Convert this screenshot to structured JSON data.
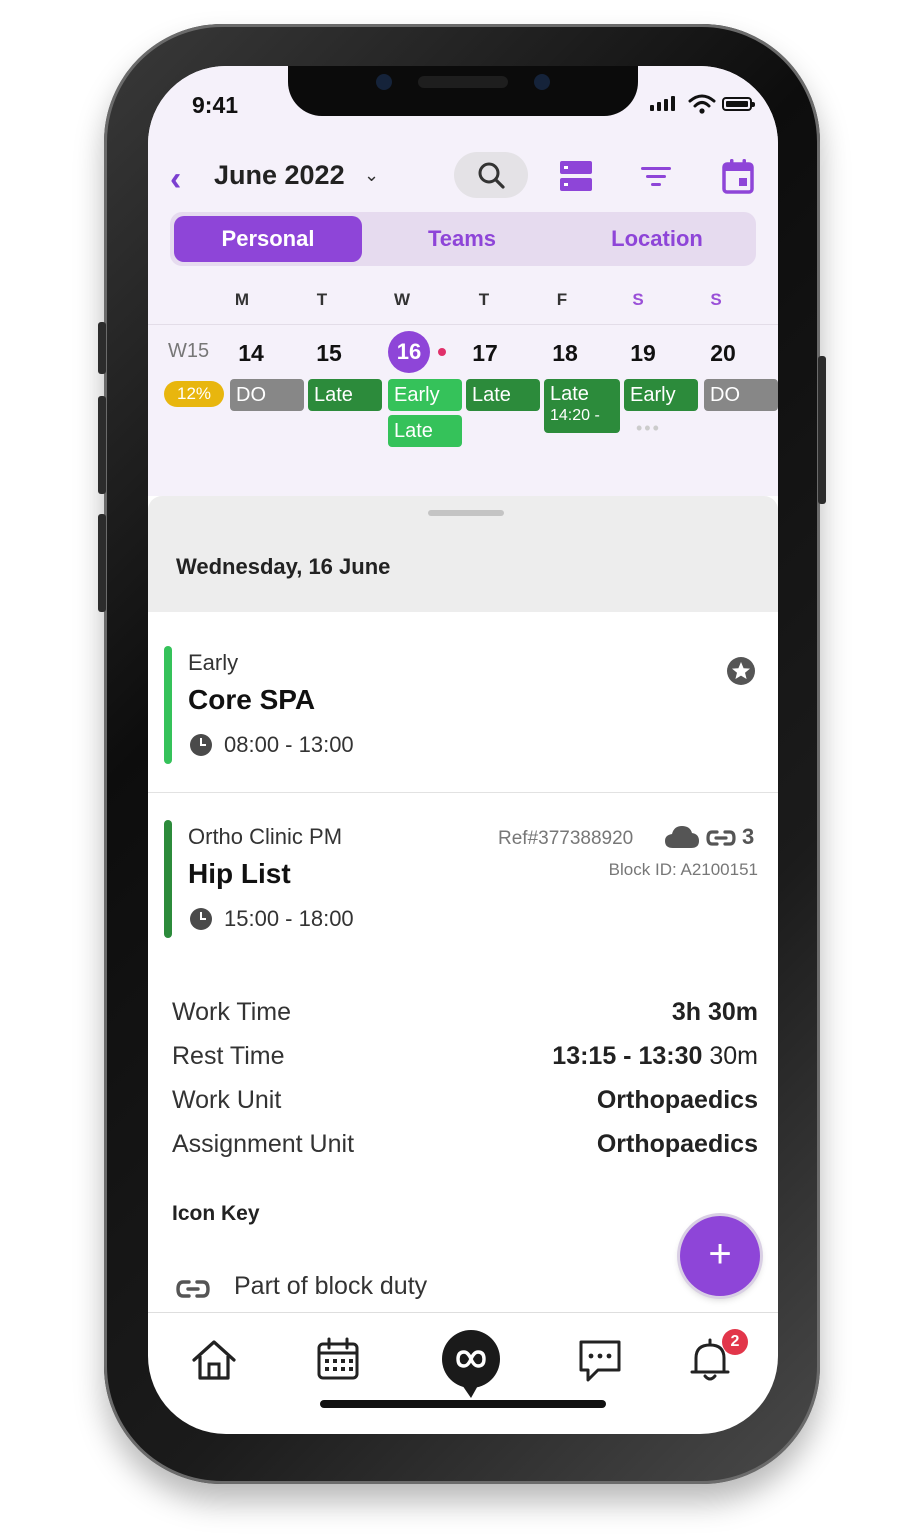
{
  "status_bar": {
    "time": "9:41"
  },
  "header": {
    "month": "June 2022",
    "back_icon": "chevron-left-icon",
    "month_dropdown_icon": "chevron-down-icon"
  },
  "toolbar": {
    "icons": [
      "search-icon",
      "storage-icon",
      "filter-icon",
      "calendar-today-icon"
    ]
  },
  "segments": {
    "active": "Personal",
    "items": [
      "Personal",
      "Teams",
      "Location"
    ]
  },
  "week": {
    "weekday_letters": [
      "M",
      "T",
      "W",
      "T",
      "F",
      "S",
      "S"
    ],
    "week_number": "W15",
    "days": [
      "14",
      "15",
      "16",
      "17",
      "18",
      "19",
      "20"
    ],
    "today": "16",
    "percent": "12%",
    "shifts": {
      "mon": "DO",
      "tue": "Late",
      "wed": [
        "Early",
        "Late"
      ],
      "thu": "Late",
      "fri": [
        "Late",
        "14:20 -"
      ],
      "sat": "Early",
      "sun": "DO"
    }
  },
  "day_detail": {
    "title": "Wednesday, 16 June",
    "shifts": [
      {
        "type": "Early",
        "name": "Core SPA",
        "time": "08:00 - 13:00",
        "bar_color": "#35c25a"
      },
      {
        "type": "Ortho Clinic PM",
        "name": "Hip List",
        "time": "15:00 - 18:00",
        "bar_color": "#2c8b3b",
        "ref": "Ref#377388920",
        "block_id": "Block ID: A2100151",
        "link_count": "3"
      }
    ],
    "details": [
      {
        "label": "Work Time",
        "value": "3h 30m"
      },
      {
        "label": "Rest Time",
        "value": "13:15 - 13:30",
        "extra": "30m"
      },
      {
        "label": "Work Unit",
        "value": "Orthopaedics"
      },
      {
        "label": "Assignment Unit",
        "value": "Orthopaedics"
      }
    ],
    "icon_key_title": "Icon Key",
    "icon_key_items": [
      {
        "icon": "link-icon",
        "label": "Part of block duty"
      }
    ]
  },
  "fab": {
    "label": "+"
  },
  "bottom_nav": {
    "items": [
      "home-icon",
      "calendar-icon",
      "chat-bubble-logo-icon",
      "message-icon",
      "bell-icon"
    ],
    "notification_count": "2"
  },
  "colors": {
    "accent": "#8e45d8",
    "shift_dark": "#2c8b3b",
    "shift_light": "#35c25a",
    "day_off": "#878787",
    "percent": "#e8b60e",
    "badge": "#e2364a"
  }
}
